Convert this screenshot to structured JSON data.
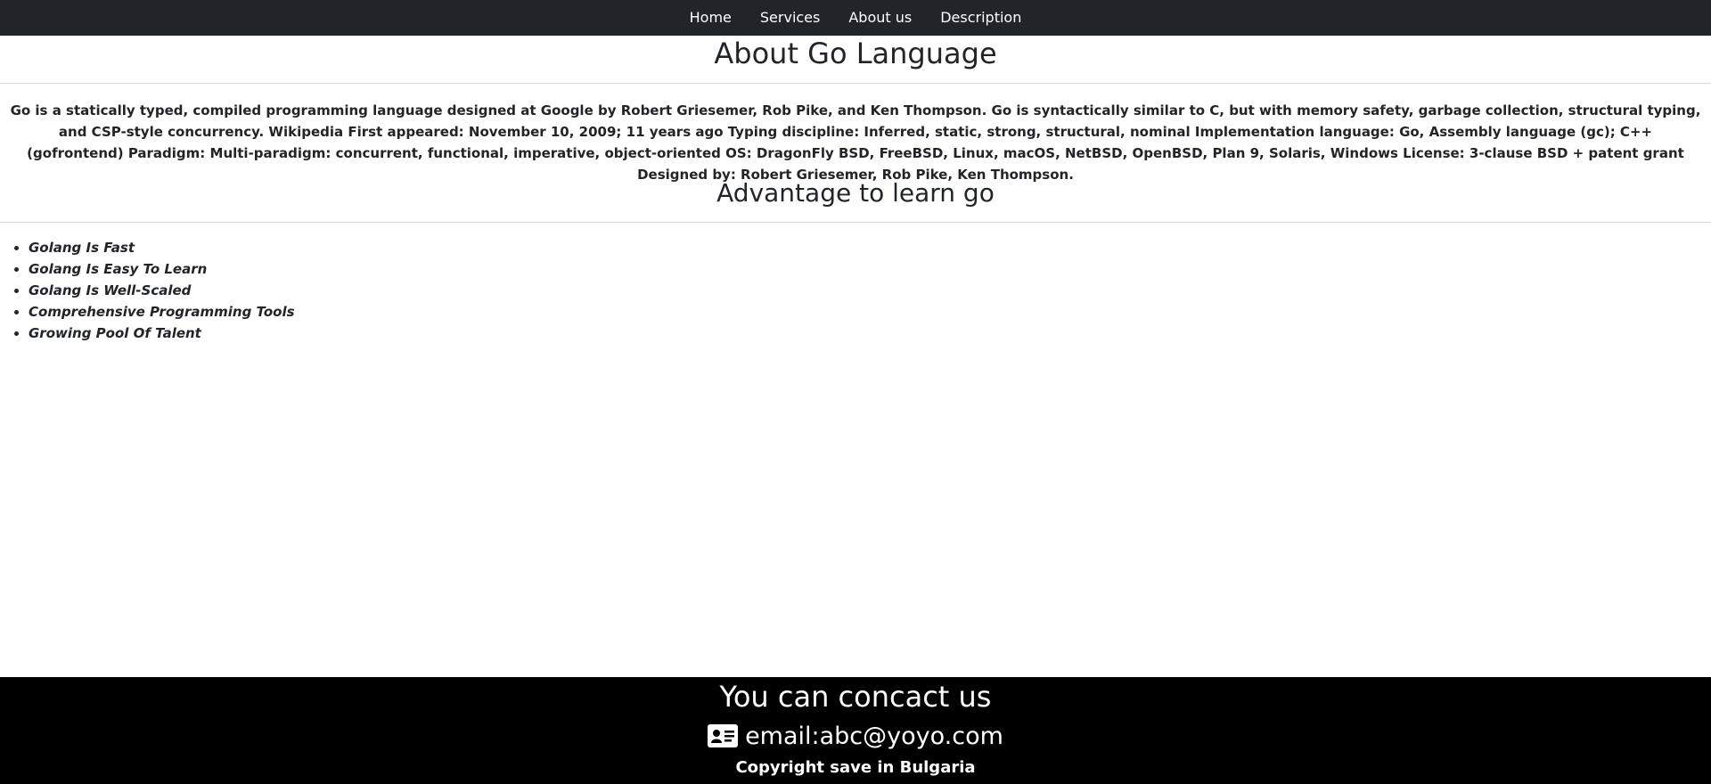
{
  "nav": {
    "items": [
      {
        "label": "Home"
      },
      {
        "label": "Services"
      },
      {
        "label": "About us"
      },
      {
        "label": "Description"
      }
    ]
  },
  "about": {
    "title": "About Go Language",
    "text": "Go is a statically typed, compiled programming language designed at Google by Robert Griesemer, Rob Pike, and Ken Thompson. Go is syntactically similar to C, but with memory safety, garbage collection, structural typing, and CSP-style concurrency. Wikipedia First appeared: November 10, 2009; 11 years ago Typing discipline: Inferred, static, strong, structural, nominal Implementation language: Go, Assembly language (gc); C++ (gofrontend) Paradigm: Multi-paradigm: concurrent, functional, imperative, object-oriented OS: DragonFly BSD, FreeBSD, Linux, macOS, NetBSD, OpenBSD, Plan 9, Solaris, Windows License: 3-clause BSD + patent grant Designed by: Robert Griesemer, Rob Pike, Ken Thompson."
  },
  "advantages": {
    "title": "Advantage to learn go",
    "items": [
      "Golang Is Fast",
      "Golang Is Easy To Learn",
      "Golang Is Well-Scaled",
      "Comprehensive Programming Tools",
      "Growing Pool Of Talent"
    ]
  },
  "footer": {
    "title": "You can concact us",
    "email_icon": "address-card-icon",
    "email": "email:abc@yoyo.com",
    "copyright": "Copyright save in Bulgaria",
    "background": "#000000"
  },
  "colors": {
    "navbar": "#212529",
    "text": "#212529"
  }
}
